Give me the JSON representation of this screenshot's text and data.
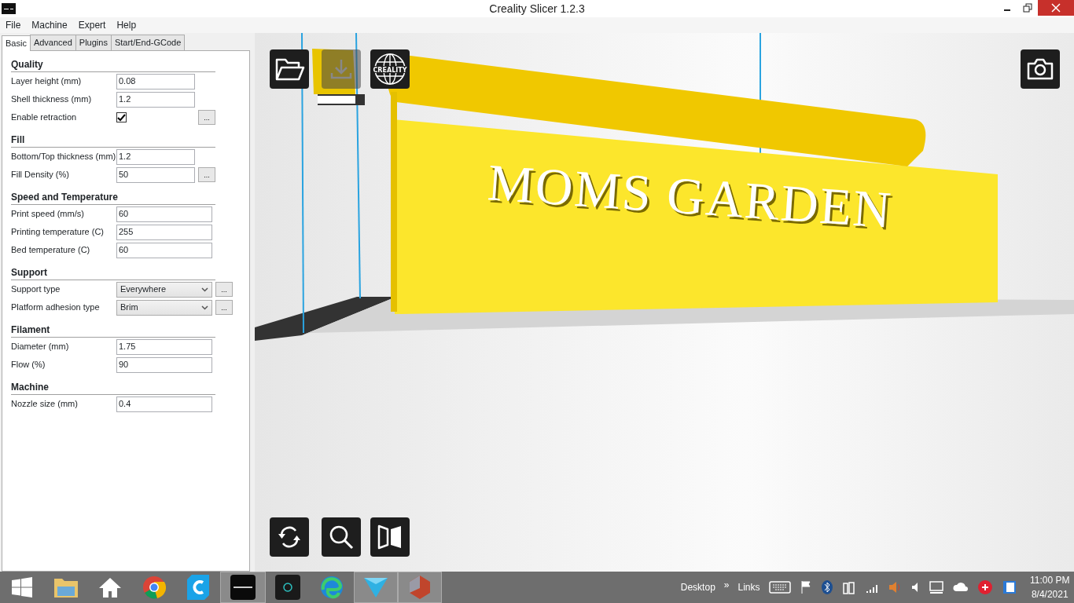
{
  "window": {
    "title": "Creality Slicer 1.2.3"
  },
  "menu": [
    "File",
    "Machine",
    "Expert",
    "Help"
  ],
  "tabs": [
    {
      "label": "Basic",
      "selected": true
    },
    {
      "label": "Advanced",
      "selected": false
    },
    {
      "label": "Plugins",
      "selected": false
    },
    {
      "label": "Start/End-GCode",
      "selected": false
    }
  ],
  "sections": [
    {
      "title": "Quality",
      "rows": [
        {
          "kind": "text",
          "label": "Layer height (mm)",
          "value": "0.08"
        },
        {
          "kind": "text",
          "label": "Shell thickness (mm)",
          "value": "1.2"
        },
        {
          "kind": "check",
          "label": "Enable retraction",
          "checked": true,
          "more": "..."
        }
      ]
    },
    {
      "title": "Fill",
      "rows": [
        {
          "kind": "text",
          "label": "Bottom/Top thickness (mm)",
          "value": "1.2"
        },
        {
          "kind": "text",
          "label": "Fill Density (%)",
          "value": "50",
          "more": "..."
        }
      ]
    },
    {
      "title": "Speed and Temperature",
      "rows": [
        {
          "kind": "text",
          "label": "Print speed (mm/s)",
          "value": "60"
        },
        {
          "kind": "text",
          "label": "Printing temperature (C)",
          "value": "255"
        },
        {
          "kind": "text",
          "label": "Bed temperature (C)",
          "value": "60"
        }
      ]
    },
    {
      "title": "Support",
      "rows": [
        {
          "kind": "select",
          "label": "Support type",
          "value": "Everywhere",
          "more": "..."
        },
        {
          "kind": "select",
          "label": "Platform adhesion type",
          "value": "Brim",
          "more": "..."
        }
      ]
    },
    {
      "title": "Filament",
      "rows": [
        {
          "kind": "text",
          "label": "Diameter (mm)",
          "value": "1.75"
        },
        {
          "kind": "text",
          "label": "Flow (%)",
          "value": "90"
        }
      ]
    },
    {
      "title": "Machine",
      "rows": [
        {
          "kind": "text",
          "label": "Nozzle size (mm)",
          "value": "0.4"
        }
      ]
    }
  ],
  "viewport": {
    "logo_text": "CREALITY",
    "model_text": "MOMS GARDEN",
    "progress": {
      "level": 0.8
    }
  },
  "taskbar": {
    "toolbars": [
      "Desktop",
      "»",
      "Links"
    ],
    "time": "11:00 PM",
    "date": "8/4/2021"
  }
}
